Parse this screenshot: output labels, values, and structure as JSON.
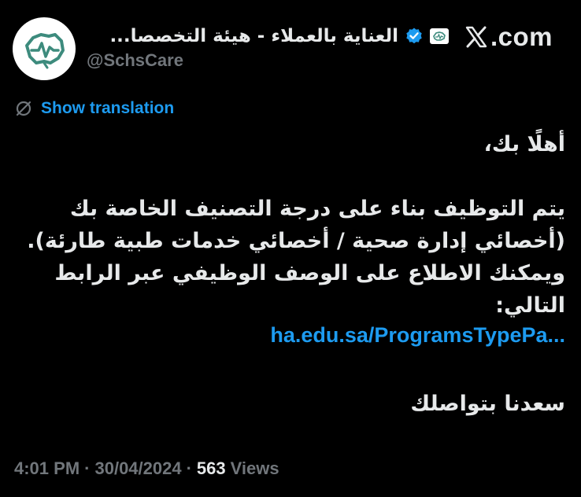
{
  "author": {
    "display_name": "العناية بالعملاء - هيئة التخصصا...",
    "handle": "@SchsCare",
    "verified": true
  },
  "site": {
    "brand": "X",
    "domain_suffix": ".com"
  },
  "translate": {
    "label": "Show translation"
  },
  "tweet": {
    "greeting": "أهلًا بك،",
    "lines": [
      "يتم التوظيف بناء على درجة التصنيف الخاصة بك",
      "(أخصائي إدارة صحية / أخصائي خدمات طبية طارئة).",
      "ويمكنك الاطلاع على الوصف الوظيفي عبر الرابط",
      "التالي:"
    ],
    "link": "ha.edu.sa/ProgramsTypePa...",
    "closing": "سعدنا بتواصلك"
  },
  "meta": {
    "time": "4:01 PM",
    "separator": "·",
    "date": "30/04/2024",
    "views_count": "563",
    "views_label": "Views"
  },
  "colors": {
    "background": "#000000",
    "text": "#e7e9ea",
    "secondary": "#71767b",
    "accent": "#1d9bf0",
    "brand_green": "#3d8b7d"
  }
}
